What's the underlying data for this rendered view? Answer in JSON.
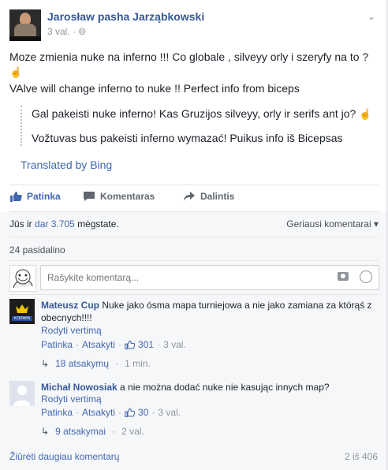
{
  "post": {
    "author": "Jarosław pasha Jarząbkowski",
    "time": "3 val.",
    "line1": "Moze zmienia nuke na inferno !!! Co globale , silveyy orly i szeryfy na to ?",
    "line2": "VAlve will change inferno to nuke !! Perfect info from biceps",
    "translation_line1": "Gal pakeisti nuke inferno! Kas Gruzijos silveyy, orly ir serifs ant jo?",
    "translation_line2": "Vožtuvas bus pakeisti inferno wymazać! Puikus info iš Bicepsas",
    "translated_by": "Translated by Bing"
  },
  "actions": {
    "like": "Patinka",
    "comment": "Komentaras",
    "share": "Dalintis"
  },
  "stats": {
    "likes_prefix": "Jūs ir",
    "likes_link": "dar 3.705",
    "likes_suffix": "mėgstate.",
    "sort": "Geriausi komentarai",
    "shares": "24 pasidalino"
  },
  "composer": {
    "placeholder": "Rašykite komentarą..."
  },
  "comments": [
    {
      "author": "Mateusz Cup",
      "text": "Nuke jako ósma mapa turniejowa a nie jako zamiana za którąś z obecnych!!!!",
      "translate": "Rodyti vertimą",
      "like": "Patinka",
      "reply": "Atsakyti",
      "likes": "301",
      "time": "3 val.",
      "replies": "18 atsakymų",
      "replies_time": "1 min.",
      "avatar_label": "KORWiN"
    },
    {
      "author": "Michał Nowosiak",
      "text": "a nie można dodać nuke nie kasując innych map?",
      "translate": "Rodyti vertimą",
      "like": "Patinka",
      "reply": "Atsakyti",
      "likes": "30",
      "time": "3 val.",
      "replies": "9 atsakymai",
      "replies_time": "2 val."
    }
  ],
  "footer": {
    "more": "Žiūrėti daugiau komentarų",
    "count": "2 iš 406"
  },
  "colors": {
    "link": "#4267b2",
    "name": "#365899",
    "muted": "#90949c"
  }
}
